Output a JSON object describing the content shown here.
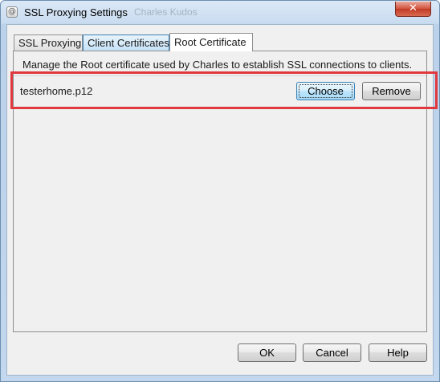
{
  "window": {
    "title": "SSL Proxying Settings",
    "title_ghost": "Charles Kudos",
    "close_glyph": "✕"
  },
  "tabs": [
    {
      "label": "SSL Proxying"
    },
    {
      "label": "Client Certificates"
    },
    {
      "label": "Root Certificate"
    }
  ],
  "panel": {
    "description": "Manage the Root certificate used by Charles to establish SSL connections to clients.",
    "certificate_file": "testerhome.p12",
    "choose_label": "Choose",
    "remove_label": "Remove"
  },
  "footer": {
    "ok_label": "OK",
    "cancel_label": "Cancel",
    "help_label": "Help"
  },
  "colors": {
    "highlight": "#e0393e",
    "close_button": "#c13a24"
  }
}
